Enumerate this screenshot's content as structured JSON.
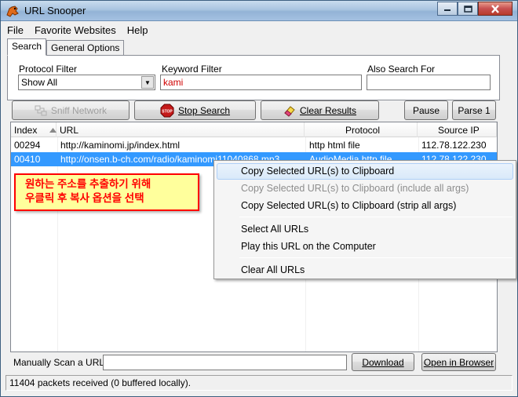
{
  "window": {
    "title": "URL Snooper"
  },
  "menu": [
    "File",
    "Favorite Websites",
    "Help"
  ],
  "tabs": [
    "Search",
    "General Options"
  ],
  "filters": {
    "protocol_label": "Protocol Filter",
    "protocol_value": "Show All",
    "keyword_label": "Keyword Filter",
    "keyword_value": "kami",
    "also_label": "Also Search For",
    "also_value": ""
  },
  "toolbar": {
    "sniff": "Sniff Network",
    "stop": "Stop Search",
    "clear": "Clear Results",
    "pause": "Pause",
    "parse": "Parse 1"
  },
  "table": {
    "headers": [
      "Index",
      "URL",
      "Protocol",
      "Source IP"
    ],
    "rows": [
      {
        "index": "00294",
        "url": "http://kaminomi.jp/index.html",
        "protocol": "http html file",
        "ip": "112.78.122.230"
      },
      {
        "index": "00410",
        "url": "http://onsen.b-ch.com/radio/kaminomi11040868.mp3",
        "protocol": "AudioMedia http file",
        "ip": "112.78.122.230"
      }
    ]
  },
  "annotation": {
    "line1": "원하는 주소를 추출하기 위해",
    "line2": "우클릭 후 복사 옵션을 선택"
  },
  "context_menu": [
    "Copy Selected URL(s) to Clipboard",
    "Copy Selected URL(s) to Clipboard (include all args)",
    "Copy Selected URL(s) to Clipboard (strip all args)",
    "Select All URLs",
    "Play this URL on the Computer",
    "Clear All URLs"
  ],
  "manual_scan": {
    "label": "Manually Scan a URL:",
    "value": "",
    "download": "Download",
    "open_browser": "Open in Browser"
  },
  "status": "11404 packets received (0 buffered locally)."
}
